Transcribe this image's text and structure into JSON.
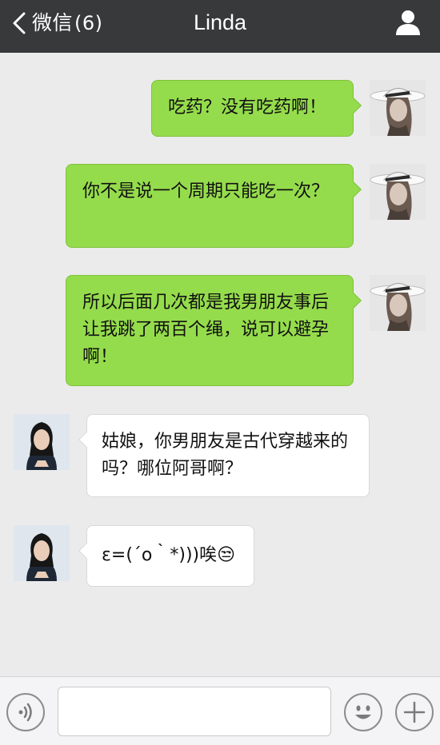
{
  "header": {
    "back_label": "微信",
    "unread_count": "(6)",
    "contact_name": "Linda"
  },
  "messages": [
    {
      "side": "out",
      "text": "吃药？没有吃药啊！"
    },
    {
      "side": "out",
      "text": "你不是说一个周期只能吃一次？"
    },
    {
      "side": "out",
      "text": "所以后面几次都是我男朋友事后让我跳了两百个绳，说可以避孕啊！"
    },
    {
      "side": "in",
      "text": "姑娘，你男朋友是古代穿越来的吗？哪位阿哥啊？"
    },
    {
      "side": "in",
      "text": "ε=(´ο｀*)))唉😒"
    }
  ],
  "input": {
    "value": "",
    "placeholder": ""
  },
  "colors": {
    "header_bg": "#37393b",
    "chat_bg": "#ebebeb",
    "outgoing_bubble": "#95dc4c",
    "incoming_bubble": "#ffffff"
  },
  "icons": {
    "back": "chevron-left-icon",
    "profile": "person-icon",
    "voice": "voice-icon",
    "emoji": "smiley-icon",
    "more": "plus-icon"
  }
}
